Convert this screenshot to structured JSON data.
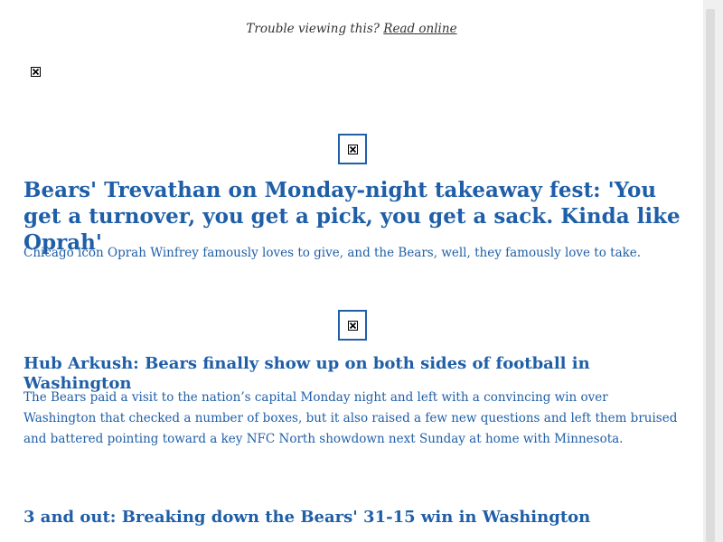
{
  "header": {
    "trouble_text": "Trouble viewing this?",
    "read_online": "Read online"
  },
  "articles": [
    {
      "headline": "Bears' Trevathan on Monday-night takeaway fest: 'You get a turnover, you get a pick, you get a sack. Kinda like Oprah'",
      "dek": "Chicago icon Oprah Winfrey famously loves to give, and the Bears, well, they famously love to take."
    },
    {
      "headline": "Hub Arkush: Bears finally show up on both sides of football in Washington",
      "dek": "The Bears paid a visit to the nation’s capital Monday night and left with a convincing win over Washington that checked a number of boxes, but it also raised a few new questions and left them bruised and battered pointing toward a key NFC North showdown next Sunday at home with Minnesota."
    },
    {
      "headline": "3 and out: Breaking down the Bears' 31-15 win in Washington"
    }
  ],
  "colors": {
    "link": "#1f5fa8",
    "text": "#333333"
  }
}
